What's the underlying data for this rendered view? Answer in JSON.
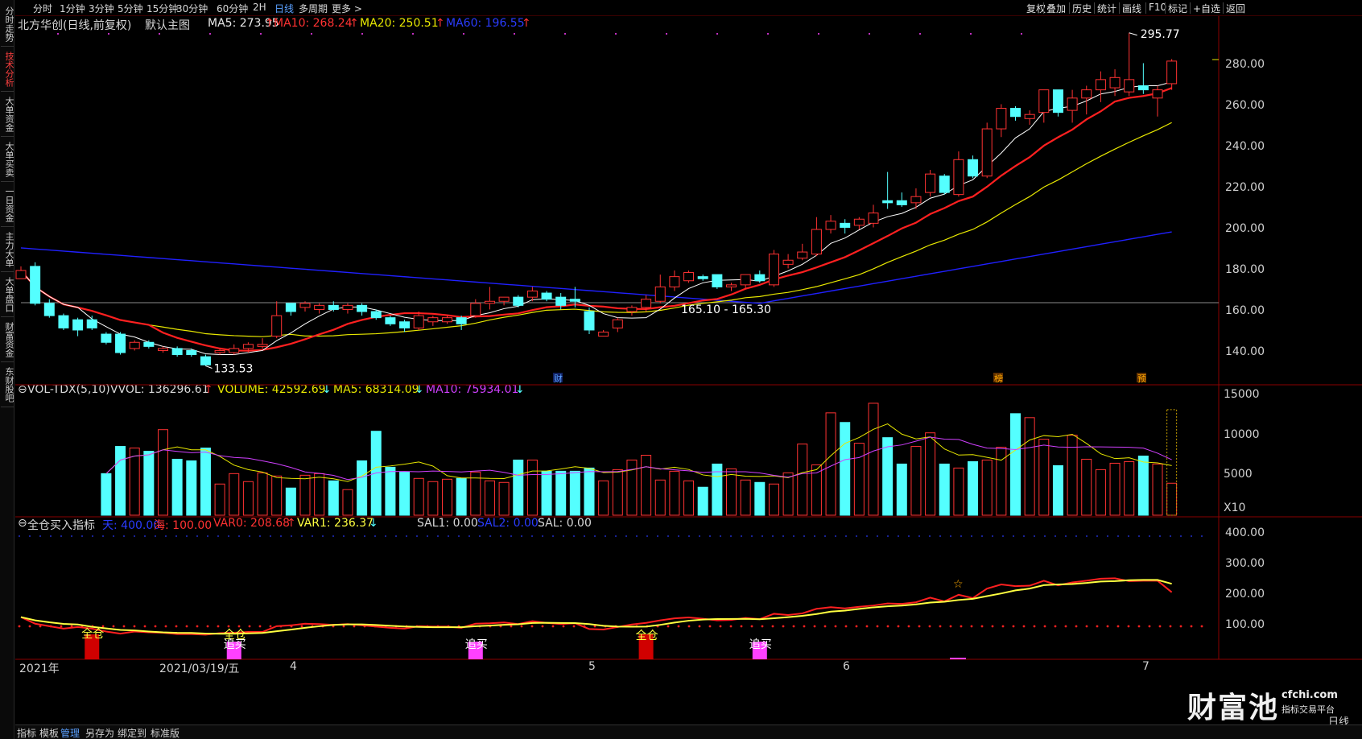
{
  "sidebar": {
    "tabs": [
      "分时走势",
      "技术分析",
      "大单资金",
      "大单买卖",
      "一日资金",
      "主力大单",
      "大单盘口",
      "财富资金",
      "东财股吧"
    ],
    "active_index": 1
  },
  "toolbar": {
    "periods": [
      "分时",
      "1分钟",
      "3分钟",
      "5分钟",
      "15分钟",
      "30分钟",
      "60分钟",
      "2H",
      "日线",
      "多周期",
      "更多 >"
    ],
    "active_period": "日线",
    "right_tools": [
      "复权",
      "叠加",
      "历史",
      "统计",
      "画线",
      "F10",
      "标记",
      "+自选",
      "返回"
    ]
  },
  "main_legend": {
    "stock": "北方华创(日线,前复权)",
    "template": "默认主图",
    "ma5": "MA5: 273.95",
    "ma10": "MA10: 268.24",
    "ma20": "MA20: 250.51",
    "ma60": "MA60: 196.55",
    "arrow_up": "↑",
    "arrow_down": "↓"
  },
  "colors": {
    "up": "#ff3232",
    "down": "#54ffff",
    "ma5": "#ffffff",
    "ma10": "#ff2020",
    "ma20": "#e8e800",
    "ma60": "#2020ff",
    "vol_ma5": "#e8e800",
    "vol_ma10": "#d040ff",
    "var0": "#ff2020",
    "var1": "#ffff40",
    "pink": "#ff40ff"
  },
  "price_axis": [
    "280.00",
    "260.00",
    "240.00",
    "220.00",
    "200.00",
    "180.00",
    "160.00",
    "140.00"
  ],
  "annotations": {
    "high": "295.77",
    "low": "133.53",
    "range": "165.10 - 165.30",
    "events": [
      "财",
      "榜",
      "预"
    ]
  },
  "vol_legend": {
    "title": "VOL-TDX(5,10)",
    "vvol": "VVOL: 136296.61",
    "volume": "VOLUME: 42592.69",
    "ma5": "MA5: 68314.09",
    "ma10": "MA10: 75934.01"
  },
  "vol_axis": [
    "15000",
    "10000",
    "5000"
  ],
  "vol_unit": "X10",
  "ind_legend": {
    "title": "全仓买入指标",
    "tian": "天: 400.00",
    "hai": "海: 100.00",
    "var0": "VAR0: 208.68",
    "var1": "VAR1: 236.37",
    "sal1": "SAL1: 0.00",
    "sal2": "SAL2: 0.00",
    "sal": "SAL: 0.00"
  },
  "ind_axis": [
    "400.00",
    "300.00",
    "200.00",
    "100.00"
  ],
  "signals": [
    "全仓",
    "全仓",
    "追买",
    "追买",
    "全仓",
    "追买"
  ],
  "date_axis": [
    "2021年",
    "2021/03/19/五",
    "4",
    "5",
    "6",
    "7"
  ],
  "period_label": "日线",
  "watermark": {
    "brand": "财富池",
    "domain": "cfchi.com",
    "tagline": "指标交易平台"
  },
  "bottom_tabs": [
    "指标",
    "模板",
    "管理",
    "另存为",
    "绑定到",
    "标准版"
  ],
  "bottom_active": "管理",
  "chart_data": {
    "type": "candlestick",
    "title": "北方华创(日线,前复权)",
    "ylim": [
      130,
      300
    ],
    "candles": [
      [
        176,
        180,
        176,
        182,
        "u"
      ],
      [
        182,
        164,
        163,
        184,
        "d"
      ],
      [
        164,
        158,
        157,
        166,
        "d"
      ],
      [
        158,
        152,
        151,
        159,
        "d"
      ],
      [
        151,
        156,
        148,
        157,
        "d"
      ],
      [
        156,
        152,
        151,
        158,
        "d"
      ],
      [
        149,
        145,
        144,
        150,
        "d"
      ],
      [
        149,
        140,
        139,
        150,
        "d"
      ],
      [
        142,
        145,
        141,
        146,
        "u"
      ],
      [
        145,
        143,
        142,
        146,
        "d"
      ],
      [
        141,
        142,
        140,
        143,
        "u"
      ],
      [
        142,
        139,
        138,
        143,
        "d"
      ],
      [
        141,
        139,
        138,
        142,
        "d"
      ],
      [
        138,
        134,
        133.53,
        139,
        "d"
      ],
      [
        140,
        141,
        139,
        142,
        "u"
      ],
      [
        140,
        142,
        139,
        144,
        "u"
      ],
      [
        142,
        144,
        140,
        145,
        "u"
      ],
      [
        143,
        144,
        142,
        147,
        "u"
      ],
      [
        148,
        158,
        147,
        165,
        "u"
      ],
      [
        164,
        160,
        158,
        164,
        "d"
      ],
      [
        162,
        164,
        160,
        165,
        "u"
      ],
      [
        161,
        163,
        159,
        164,
        "u"
      ],
      [
        163,
        161,
        160,
        165,
        "d"
      ],
      [
        161,
        163,
        159,
        164,
        "u"
      ],
      [
        163,
        160,
        158,
        164,
        "d"
      ],
      [
        160,
        157,
        156,
        161,
        "d"
      ],
      [
        157,
        154,
        153,
        158,
        "d"
      ],
      [
        155,
        152,
        150,
        156,
        "d"
      ],
      [
        152,
        158,
        151,
        160,
        "u"
      ],
      [
        155,
        157,
        153,
        158,
        "u"
      ],
      [
        155,
        157,
        154,
        158,
        "u"
      ],
      [
        157,
        154,
        151,
        158,
        "d"
      ],
      [
        158,
        164,
        157,
        166,
        "u"
      ],
      [
        164,
        165,
        161,
        172,
        "u"
      ],
      [
        165,
        167,
        163,
        167,
        "u"
      ],
      [
        167,
        163,
        162,
        168,
        "d"
      ],
      [
        167,
        170,
        165,
        172,
        "u"
      ],
      [
        169,
        166,
        165,
        170,
        "d"
      ],
      [
        167,
        163,
        161,
        169,
        "d"
      ],
      [
        166,
        165,
        162,
        172,
        "d"
      ],
      [
        160,
        151,
        149,
        162,
        "d"
      ],
      [
        148,
        150,
        148,
        151,
        "u"
      ],
      [
        152,
        156,
        150,
        157,
        "u"
      ],
      [
        160,
        162,
        158,
        163,
        "u"
      ],
      [
        162,
        166,
        160,
        168,
        "u"
      ],
      [
        165,
        172,
        164,
        178,
        "u"
      ],
      [
        172,
        177,
        170,
        180,
        "u"
      ],
      [
        175,
        179,
        174,
        180,
        "u"
      ],
      [
        177,
        176,
        175,
        178,
        "d"
      ],
      [
        178,
        172,
        171,
        178,
        "d"
      ],
      [
        172,
        173,
        170,
        174,
        "u"
      ],
      [
        173,
        178,
        171,
        178,
        "u"
      ],
      [
        178,
        175,
        174,
        180,
        "d"
      ],
      [
        173,
        188,
        172,
        190,
        "u"
      ],
      [
        183,
        185,
        181,
        188,
        "u"
      ],
      [
        186,
        189,
        185,
        193,
        "u"
      ],
      [
        188,
        200,
        187,
        206,
        "u"
      ],
      [
        200,
        204,
        198,
        207,
        "u"
      ],
      [
        203,
        201,
        198,
        205,
        "d"
      ],
      [
        202,
        205,
        200,
        206,
        "u"
      ],
      [
        203,
        208,
        201,
        212,
        "u"
      ],
      [
        214,
        213,
        210,
        228,
        "d"
      ],
      [
        214,
        212,
        211,
        218,
        "d"
      ],
      [
        213,
        216,
        210,
        220,
        "u"
      ],
      [
        218,
        227,
        216,
        229,
        "u"
      ],
      [
        226,
        218,
        217,
        227,
        "d"
      ],
      [
        217,
        234,
        216,
        238,
        "u"
      ],
      [
        234,
        226,
        225,
        236,
        "d"
      ],
      [
        226,
        249,
        225,
        252,
        "u"
      ],
      [
        249,
        259,
        245,
        261,
        "u"
      ],
      [
        259,
        255,
        253,
        260,
        "d"
      ],
      [
        254,
        256,
        251,
        258,
        "u"
      ],
      [
        257,
        268,
        252,
        268,
        "u"
      ],
      [
        268,
        257,
        255,
        268,
        "d"
      ],
      [
        258,
        264,
        252,
        268,
        "u"
      ],
      [
        264,
        268,
        256,
        270,
        "u"
      ],
      [
        268,
        273,
        262,
        277,
        "u"
      ],
      [
        269,
        274,
        265,
        278,
        "u"
      ],
      [
        273,
        267,
        265,
        295.77,
        "u"
      ],
      [
        270,
        268,
        266,
        281,
        "d"
      ],
      [
        264,
        268,
        255,
        270,
        "u"
      ],
      [
        271,
        282,
        268,
        283,
        "u"
      ]
    ],
    "volume": [
      5200,
      8600,
      8400,
      8000,
      10700,
      7000,
      6800,
      8400,
      3900,
      5200,
      4200,
      5300,
      4900,
      3400,
      5000,
      5200,
      4300,
      3200,
      6800,
      10500,
      6000,
      5400,
      4600,
      4200,
      4500,
      4600,
      5400,
      4300,
      4100,
      6900,
      6900,
      5500,
      5500,
      5500,
      5900,
      4300,
      5700,
      6900,
      7500,
      4400,
      5500,
      4300,
      3500,
      6400,
      5800,
      4400,
      4100,
      3900,
      5300,
      8900,
      6300,
      12800,
      11600,
      9000,
      14000,
      9700,
      6400,
      8600,
      10300,
      6400,
      5900,
      6700,
      6900,
      8500,
      12700,
      12200,
      9500,
      6200,
      10000,
      7000,
      5700,
      6500,
      6700,
      7400,
      6400,
      4000
    ],
    "vol_units": "X10"
  }
}
